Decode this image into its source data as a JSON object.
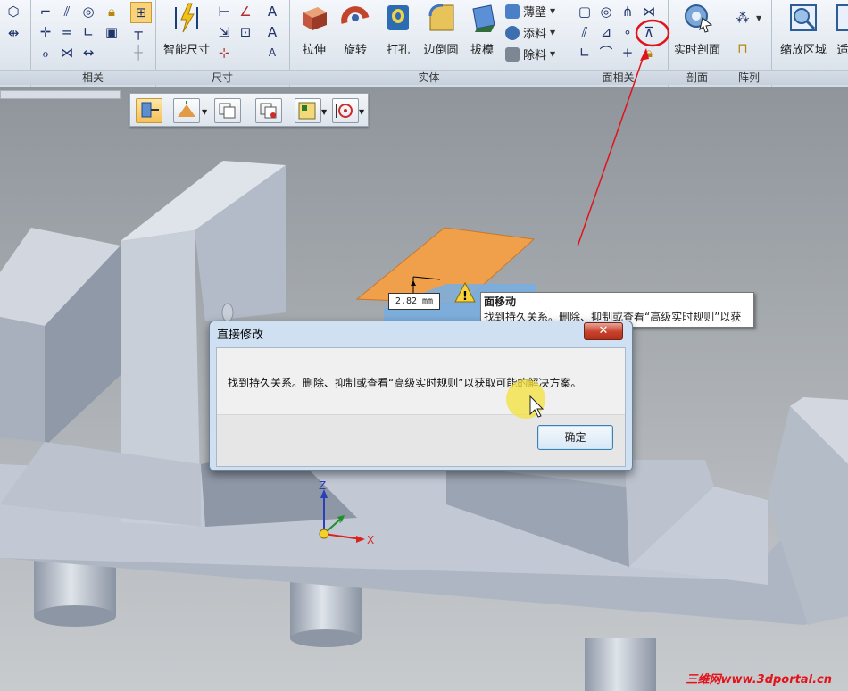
{
  "ribbon": {
    "groups": {
      "relations": "相关",
      "dimension": "尺寸",
      "solid": "实体",
      "face_relations": "面相关",
      "section": "剖面",
      "array": "阵列"
    },
    "buttons": {
      "smart_dimension": "智能尺寸",
      "extrude": "拉伸",
      "revolve": "旋转",
      "hole": "打孔",
      "round": "边倒圆",
      "draft": "拔模",
      "thin_wall": "薄壁",
      "add": "添料",
      "remove": "除料",
      "live_section": "实时剖面",
      "zoom_area": "缩放区域",
      "fit_partial": "适"
    }
  },
  "viewport": {
    "dimension_value": "2.82 mm",
    "triad": {
      "z": "Z",
      "y": "Y",
      "x": "X"
    }
  },
  "tooltip": {
    "title": "面移动",
    "body": "找到持久关系。删除、抑制或查看“高级实时规则”以获"
  },
  "dialog": {
    "title": "直接修改",
    "message": "找到持久关系。删除、抑制或查看“高级实时规则”以获取可能的解决方案。",
    "close_label": "✕",
    "ok_label": "确定"
  },
  "watermark": "三维网www.3dportal.cn",
  "colors": {
    "annotation_red": "#e0141a",
    "highlight_face": "#f0a04b",
    "cursor_highlight": "#f4e23a",
    "dialog_frame": "#cfe0f2"
  }
}
